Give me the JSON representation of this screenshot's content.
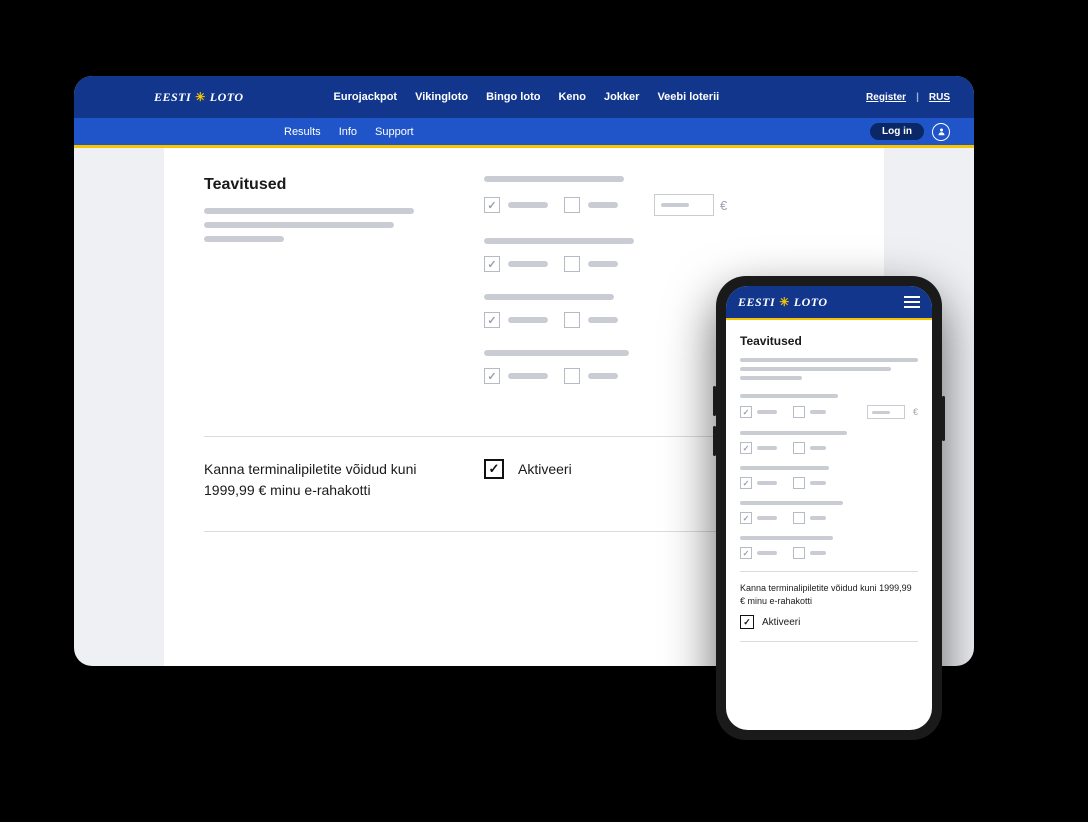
{
  "brand": {
    "part1": "EESTI",
    "part2": "LOTO"
  },
  "nav": {
    "items": [
      "Eurojackpot",
      "Vikingloto",
      "Bingo loto",
      "Keno",
      "Jokker",
      "Veebi loterii"
    ],
    "register": "Register",
    "lang": "RUS"
  },
  "subnav": {
    "items": [
      "Results",
      "Info",
      "Support"
    ],
    "login": "Log in"
  },
  "page": {
    "title": "Teavitused",
    "currency": "€"
  },
  "activate": {
    "text_line1": "Kanna terminalipiletite võidud kuni",
    "text_line2": "1999,99 € minu e-rahakotti",
    "label": "Aktiveeri",
    "checked": true
  },
  "mobile": {
    "title": "Teavitused",
    "activate_text": "Kanna terminalipiletite võidud kuni 1999,99 € minu e-rahakotti",
    "activate_label": "Aktiveeri",
    "activate_checked": true
  }
}
